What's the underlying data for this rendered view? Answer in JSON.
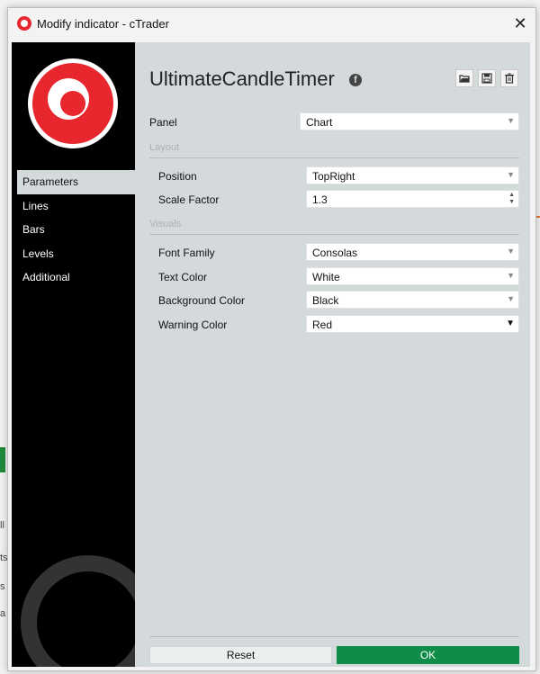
{
  "window": {
    "title": "Modify indicator - cTrader",
    "close_label": "✕"
  },
  "background": {
    "fragments": [
      "ll",
      "ts",
      "s",
      "a"
    ]
  },
  "sidebar": {
    "items": [
      {
        "label": "Parameters",
        "active": true
      },
      {
        "label": "Lines",
        "active": false
      },
      {
        "label": "Bars",
        "active": false
      },
      {
        "label": "Levels",
        "active": false
      },
      {
        "label": "Additional",
        "active": false
      }
    ]
  },
  "main": {
    "title": "UltimateCandleTimer",
    "fb_glyph": "f",
    "toolbar": {
      "icons": [
        "open-folder-icon",
        "save-icon",
        "trash-icon"
      ]
    },
    "panel": {
      "label": "Panel",
      "value": "Chart"
    },
    "layout": {
      "section_label": "Layout",
      "position": {
        "label": "Position",
        "value": "TopRight"
      },
      "scale_factor": {
        "label": "Scale Factor",
        "value": "1.3"
      }
    },
    "visuals": {
      "section_label": "Visuals",
      "font_family": {
        "label": "Font Family",
        "value": "Consolas"
      },
      "text_color": {
        "label": "Text Color",
        "value": "White"
      },
      "background_color": {
        "label": "Background Color",
        "value": "Black"
      },
      "warning_color": {
        "label": "Warning Color",
        "value": "Red"
      }
    },
    "arrow_glyph": "▼",
    "spinner_up": "▲",
    "spinner_down": "▼"
  },
  "footer": {
    "reset_label": "Reset",
    "ok_label": "OK"
  },
  "colors": {
    "accent_ok": "#0d8d47",
    "brand_red": "#e8262d",
    "content_bg": "#d4d9dc",
    "sidebar_bg": "#000000"
  }
}
